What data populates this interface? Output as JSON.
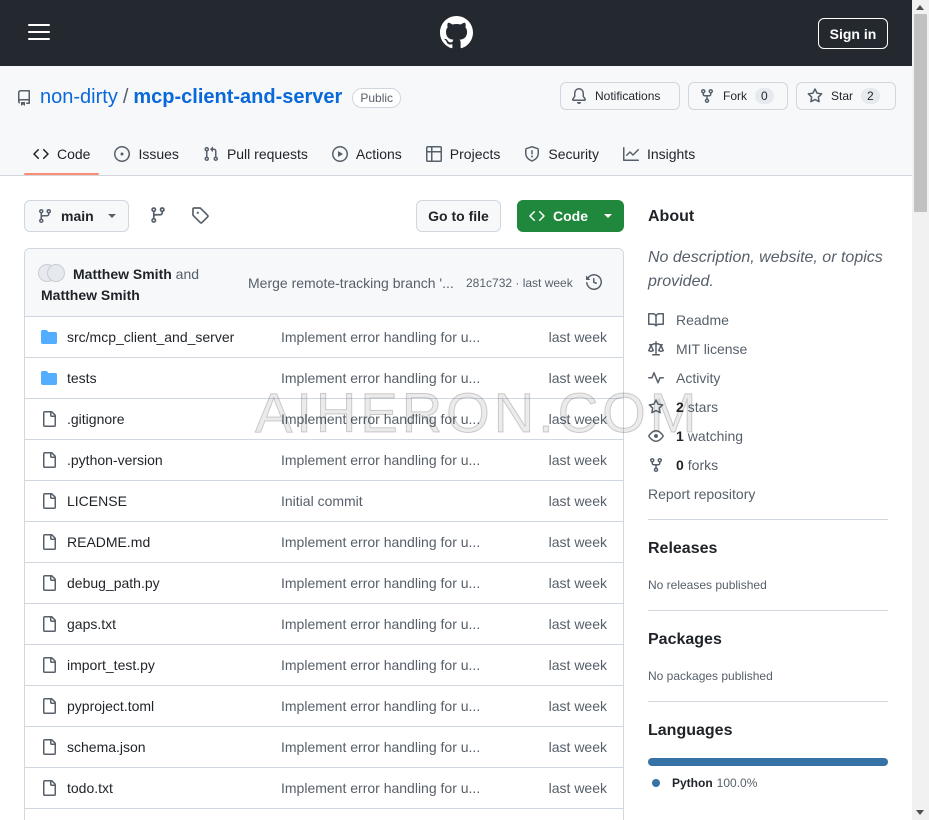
{
  "header": {
    "signin_label": "Sign in"
  },
  "repo": {
    "owner": "non-dirty",
    "separator": "/",
    "name": "mcp-client-and-server",
    "visibility": "Public",
    "notifications_label": "Notifications",
    "fork_label": "Fork",
    "fork_count": "0",
    "star_label": "Star",
    "star_count": "2"
  },
  "tabs": [
    {
      "label": "Code",
      "icon": "code-icon",
      "active": true
    },
    {
      "label": "Issues",
      "icon": "issue-opened-icon"
    },
    {
      "label": "Pull requests",
      "icon": "git-pull-request-icon"
    },
    {
      "label": "Actions",
      "icon": "play-icon"
    },
    {
      "label": "Projects",
      "icon": "table-icon"
    },
    {
      "label": "Security",
      "icon": "shield-icon"
    },
    {
      "label": "Insights",
      "icon": "graph-icon"
    }
  ],
  "toolbar": {
    "branch": "main",
    "goto_file_label": "Go to file",
    "code_label": "Code"
  },
  "commit": {
    "author1": "Matthew Smith",
    "and_text": "and",
    "author2": "Matthew Smith",
    "message": "Merge remote-tracking branch '...",
    "hash_info": "281c732 · last week"
  },
  "files": [
    {
      "name": "src/mcp_client_and_server",
      "type": "dir",
      "message": "Implement error handling for u...",
      "date": "last week"
    },
    {
      "name": "tests",
      "type": "dir",
      "message": "Implement error handling for u...",
      "date": "last week"
    },
    {
      "name": ".gitignore",
      "type": "file",
      "message": "Implement error handling for u...",
      "date": "last week"
    },
    {
      "name": ".python-version",
      "type": "file",
      "message": "Implement error handling for u...",
      "date": "last week"
    },
    {
      "name": "LICENSE",
      "type": "file",
      "message": "Initial commit",
      "date": "last week"
    },
    {
      "name": "README.md",
      "type": "file",
      "message": "Implement error handling for u...",
      "date": "last week"
    },
    {
      "name": "debug_path.py",
      "type": "file",
      "message": "Implement error handling for u...",
      "date": "last week"
    },
    {
      "name": "gaps.txt",
      "type": "file",
      "message": "Implement error handling for u...",
      "date": "last week"
    },
    {
      "name": "import_test.py",
      "type": "file",
      "message": "Implement error handling for u...",
      "date": "last week"
    },
    {
      "name": "pyproject.toml",
      "type": "file",
      "message": "Implement error handling for u...",
      "date": "last week"
    },
    {
      "name": "schema.json",
      "type": "file",
      "message": "Implement error handling for u...",
      "date": "last week"
    },
    {
      "name": "todo.txt",
      "type": "file",
      "message": "Implement error handling for u...",
      "date": "last week"
    }
  ],
  "about": {
    "title": "About",
    "description": "No description, website, or topics provided.",
    "readme": "Readme",
    "license": "MIT license",
    "activity": "Activity",
    "stars_count": "2",
    "stars_label": "stars",
    "watching_count": "1",
    "watching_label": "watching",
    "forks_count": "0",
    "forks_label": "forks",
    "report": "Report repository"
  },
  "releases": {
    "title": "Releases",
    "note": "No releases published"
  },
  "packages": {
    "title": "Packages",
    "note": "No packages published"
  },
  "languages": {
    "title": "Languages",
    "items": [
      {
        "name": "Python",
        "percent": "100.0%",
        "fraction": 1.0,
        "color": "#3572a5"
      }
    ]
  },
  "watermark": "AIHERON.COM",
  "colors": {
    "accent_green": "#1f883d",
    "link_blue": "#0969da",
    "tab_underline": "#fd8c73",
    "header_dark": "#24292f",
    "folder_blue": "#54aeff"
  }
}
